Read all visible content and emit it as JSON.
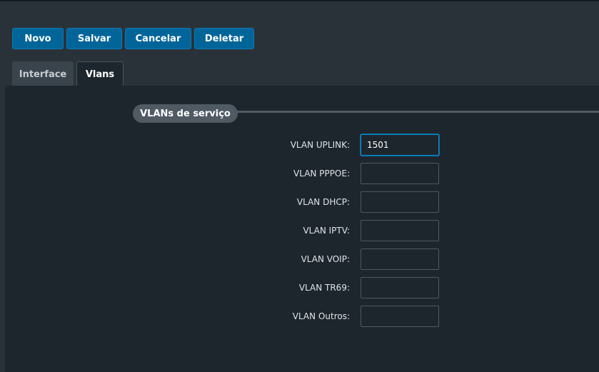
{
  "toolbar": {
    "novo_label": "Novo",
    "salvar_label": "Salvar",
    "cancelar_label": "Cancelar",
    "deletar_label": "Deletar"
  },
  "tabs": [
    {
      "label": "Interface",
      "active": false
    },
    {
      "label": "Vlans",
      "active": true
    }
  ],
  "section": {
    "title": "VLANs de serviço"
  },
  "fields": [
    {
      "label": "VLAN UPLINK:",
      "value": "1501",
      "focused": true
    },
    {
      "label": "VLAN PPPOE:",
      "value": ""
    },
    {
      "label": "VLAN DHCP:",
      "value": ""
    },
    {
      "label": "VLAN IPTV:",
      "value": ""
    },
    {
      "label": "VLAN VOIP:",
      "value": ""
    },
    {
      "label": "VLAN TR69:",
      "value": ""
    },
    {
      "label": "VLAN Outros:",
      "value": ""
    }
  ],
  "colors": {
    "accent": "#02659a",
    "background": "#1e262d",
    "header": "#2a3239",
    "focus_border": "#0b88c9"
  }
}
